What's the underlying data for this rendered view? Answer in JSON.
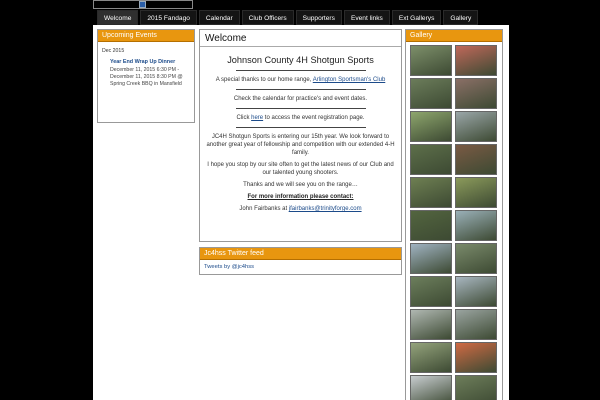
{
  "nav": {
    "items": [
      "Welcome",
      "2015 Fandago",
      "Calendar",
      "Club Officers",
      "Supporters",
      "Event links",
      "Ext Gallerys",
      "Gallery"
    ],
    "active_index": 0
  },
  "events": {
    "header": "Upcoming Events",
    "month": "Dec 2015",
    "title": "Year End Wrap Up Dinner",
    "detail": "December 11, 2015 6:30 PM - December 11, 2015 8:30 PM @ Spring Creek BBQ in Mansfield"
  },
  "welcome": {
    "title": "Welcome",
    "heading": "Johnson County 4H Shotgun Sports",
    "thanks_prefix": "A special thanks to our home range, ",
    "thanks_link": "Arlington Sportsman's Club",
    "calendar_note": "Check the calendar for practice's and event dates.",
    "click_prefix": "Click ",
    "click_link": "here",
    "click_suffix": " to access the event registration page.",
    "para1": "JC4H Shotgun Sports is entering our 15th year. We look forward to another great year of fellowship and competition with our extended 4-H family.",
    "para2": "I hope you stop by our site often to get the latest news of our Club and our talented young shooters.",
    "para3": "Thanks and we will see you on the range…",
    "more_info": "For more information please contact:",
    "contact_prefix": "John Fairbanks at ",
    "contact_email": "jfairbanks@trinityforge.com"
  },
  "twitter": {
    "header": "Jc4hss Twitter feed",
    "link": "Tweets by @jc4hss"
  },
  "gallery": {
    "header": "Gallery",
    "thumb_colors": [
      [
        "#7d8f6a",
        "#c0685a"
      ],
      [
        "#6b7c5a",
        "#8a6f66"
      ],
      [
        "#8ea66d",
        "#9aa6a8"
      ],
      [
        "#5d6f4a",
        "#7a5a44"
      ],
      [
        "#6e7f52",
        "#8b9a5b"
      ],
      [
        "#53653f",
        "#9ab0b8"
      ],
      [
        "#a0b3c2",
        "#7a8a6b"
      ],
      [
        "#6c7e5c",
        "#a8b6c0"
      ],
      [
        "#b0b8b2",
        "#9aa4a0"
      ],
      [
        "#94a37c",
        "#d06a44"
      ],
      [
        "#c8cdd0",
        "#6d7d5a"
      ]
    ]
  }
}
